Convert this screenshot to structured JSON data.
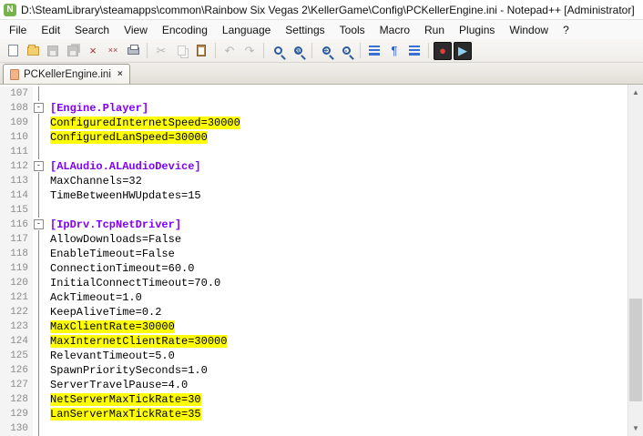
{
  "window": {
    "title": "D:\\SteamLibrary\\steamapps\\common\\Rainbow Six Vegas 2\\KellerGame\\Config\\PCKellerEngine.ini - Notepad++ [Administrator]",
    "app_icon_letter": "N"
  },
  "menu_bar": {
    "items": [
      "File",
      "Edit",
      "Search",
      "View",
      "Encoding",
      "Language",
      "Settings",
      "Tools",
      "Macro",
      "Run",
      "Plugins",
      "Window",
      "?"
    ]
  },
  "toolbar": {
    "items": [
      {
        "name": "new-file",
        "kind": "page"
      },
      {
        "name": "open-file",
        "kind": "folder"
      },
      {
        "name": "save",
        "kind": "disk",
        "disabled": true
      },
      {
        "name": "save-all",
        "kind": "disk2",
        "disabled": true
      },
      {
        "name": "close",
        "kind": "glyph",
        "glyph": "×",
        "color": "#a03535"
      },
      {
        "name": "close-all",
        "kind": "glyph",
        "glyph": "××",
        "color": "#a03535"
      },
      {
        "name": "print",
        "kind": "printer"
      },
      {
        "name": "sep1",
        "kind": "sep"
      },
      {
        "name": "cut",
        "kind": "glyph",
        "glyph": "✂",
        "color": "#4a5c72",
        "disabled": true
      },
      {
        "name": "copy",
        "kind": "pages",
        "disabled": true
      },
      {
        "name": "paste",
        "kind": "clip"
      },
      {
        "name": "sep2",
        "kind": "sep"
      },
      {
        "name": "undo",
        "kind": "glyph",
        "glyph": "↶",
        "color": "#2d5d9e",
        "disabled": true
      },
      {
        "name": "redo",
        "kind": "glyph",
        "glyph": "↷",
        "color": "#2d5d9e",
        "disabled": true
      },
      {
        "name": "sep3",
        "kind": "sep"
      },
      {
        "name": "find",
        "kind": "mag"
      },
      {
        "name": "replace",
        "kind": "mag-ab"
      },
      {
        "name": "sep4",
        "kind": "sep"
      },
      {
        "name": "zoom-in",
        "kind": "mag-plus"
      },
      {
        "name": "zoom-out",
        "kind": "mag-minus"
      },
      {
        "name": "sep5",
        "kind": "sep"
      },
      {
        "name": "word-wrap",
        "kind": "bars"
      },
      {
        "name": "show-all-characters",
        "kind": "glyph",
        "glyph": "¶",
        "color": "#2e5bd7"
      },
      {
        "name": "indent-guide",
        "kind": "bars"
      },
      {
        "name": "sep6",
        "kind": "sep"
      },
      {
        "name": "record-macro",
        "kind": "glyph-boxed",
        "glyph": "●",
        "color": "#e23c3c"
      },
      {
        "name": "playback-macro",
        "kind": "glyph-boxed",
        "glyph": "▶",
        "color": "#8fd0f0"
      }
    ]
  },
  "tab_bar": {
    "tabs": [
      {
        "label": "PCKellerEngine.ini",
        "active": true,
        "close_glyph": "×"
      }
    ]
  },
  "editor": {
    "lines": [
      {
        "num": 107,
        "text": "",
        "type": "blank",
        "fold": "mid",
        "highlight": false
      },
      {
        "num": 108,
        "text": "[Engine.Player]",
        "type": "section",
        "fold": "start",
        "highlight": false
      },
      {
        "num": 109,
        "text": "ConfiguredInternetSpeed=30000",
        "type": "key",
        "fold": "mid",
        "highlight": true
      },
      {
        "num": 110,
        "text": "ConfiguredLanSpeed=30000",
        "type": "key",
        "fold": "mid",
        "highlight": true
      },
      {
        "num": 111,
        "text": "",
        "type": "blank",
        "fold": "mid",
        "highlight": false
      },
      {
        "num": 112,
        "text": "[ALAudio.ALAudioDevice]",
        "type": "section",
        "fold": "start",
        "highlight": false
      },
      {
        "num": 113,
        "text": "MaxChannels=32",
        "type": "key",
        "fold": "mid",
        "highlight": false
      },
      {
        "num": 114,
        "text": "TimeBetweenHWUpdates=15",
        "type": "key",
        "fold": "mid",
        "highlight": false
      },
      {
        "num": 115,
        "text": "",
        "type": "blank",
        "fold": "mid",
        "highlight": false
      },
      {
        "num": 116,
        "text": "[IpDrv.TcpNetDriver]",
        "type": "section",
        "fold": "start",
        "highlight": false
      },
      {
        "num": 117,
        "text": "AllowDownloads=False",
        "type": "key",
        "fold": "mid",
        "highlight": false
      },
      {
        "num": 118,
        "text": "EnableTimeout=False",
        "type": "key",
        "fold": "mid",
        "highlight": false
      },
      {
        "num": 119,
        "text": "ConnectionTimeout=60.0",
        "type": "key",
        "fold": "mid",
        "highlight": false
      },
      {
        "num": 120,
        "text": "InitialConnectTimeout=70.0",
        "type": "key",
        "fold": "mid",
        "highlight": false
      },
      {
        "num": 121,
        "text": "AckTimeout=1.0",
        "type": "key",
        "fold": "mid",
        "highlight": false
      },
      {
        "num": 122,
        "text": "KeepAliveTime=0.2",
        "type": "key",
        "fold": "mid",
        "highlight": false
      },
      {
        "num": 123,
        "text": "MaxClientRate=30000",
        "type": "key",
        "fold": "mid",
        "highlight": true
      },
      {
        "num": 124,
        "text": "MaxInternetClientRate=30000",
        "type": "key",
        "fold": "mid",
        "highlight": true
      },
      {
        "num": 125,
        "text": "RelevantTimeout=5.0",
        "type": "key",
        "fold": "mid",
        "highlight": false
      },
      {
        "num": 126,
        "text": "SpawnPrioritySeconds=1.0",
        "type": "key",
        "fold": "mid",
        "highlight": false
      },
      {
        "num": 127,
        "text": "ServerTravelPause=4.0",
        "type": "key",
        "fold": "mid",
        "highlight": false
      },
      {
        "num": 128,
        "text": "NetServerMaxTickRate=30",
        "type": "key",
        "fold": "mid",
        "highlight": true
      },
      {
        "num": 129,
        "text": "LanServerMaxTickRate=35",
        "type": "key",
        "fold": "mid",
        "highlight": true
      },
      {
        "num": 130,
        "text": "",
        "type": "blank",
        "fold": "mid",
        "highlight": false
      }
    ],
    "colors": {
      "section": "#8000ff",
      "highlight": "#ffff00",
      "line_number": "#8a8a8a"
    },
    "fold_collapse_glyph": "-"
  },
  "scrollbar": {
    "up_glyph": "▲",
    "down_glyph": "▼"
  }
}
